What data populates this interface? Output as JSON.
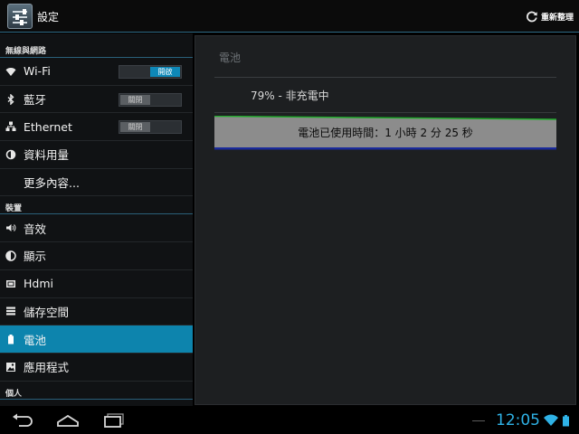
{
  "action_bar": {
    "title": "設定",
    "refresh_label": "重新整理",
    "icons": {
      "app": "settings-app-icon",
      "refresh": "refresh-icon"
    }
  },
  "sidebar": {
    "sections": [
      {
        "header": "無線與網路",
        "items": [
          {
            "label": "Wi-Fi",
            "icon": "wifi-icon",
            "switch": "開啟",
            "switch_on": true
          },
          {
            "label": "藍牙",
            "icon": "bluetooth-icon",
            "switch": "關閉",
            "switch_on": false
          },
          {
            "label": "Ethernet",
            "icon": "ethernet-icon",
            "switch": "關閉",
            "switch_on": false
          },
          {
            "label": "資料用量",
            "icon": "data-usage-icon"
          },
          {
            "label": "更多內容..."
          }
        ]
      },
      {
        "header": "裝置",
        "items": [
          {
            "label": "音效",
            "icon": "sound-icon"
          },
          {
            "label": "顯示",
            "icon": "display-icon"
          },
          {
            "label": "Hdmi",
            "icon": "hdmi-icon"
          },
          {
            "label": "儲存空間",
            "icon": "storage-icon"
          },
          {
            "label": "電池",
            "icon": "battery-icon",
            "selected": true
          },
          {
            "label": "應用程式",
            "icon": "apps-icon"
          }
        ]
      },
      {
        "header": "個人",
        "items": []
      }
    ]
  },
  "battery": {
    "section_title": "電池",
    "status": "79% - 非充電中",
    "usage_time": "電池已使用時間：1 小時 2 分 25 秒",
    "level_percent": 79
  },
  "nav_bar": {
    "clock": "12:05",
    "icons": {
      "back": "back-icon",
      "home": "home-icon",
      "recents": "recent-apps-icon",
      "wifi": "wifi-signal-icon",
      "battery": "battery-status-icon"
    }
  },
  "colors": {
    "accent": "#0d84ad",
    "holo_blue": "#2fb2e6",
    "graph_fill": "#8c8c8c",
    "graph_line": "#1fa82a"
  }
}
